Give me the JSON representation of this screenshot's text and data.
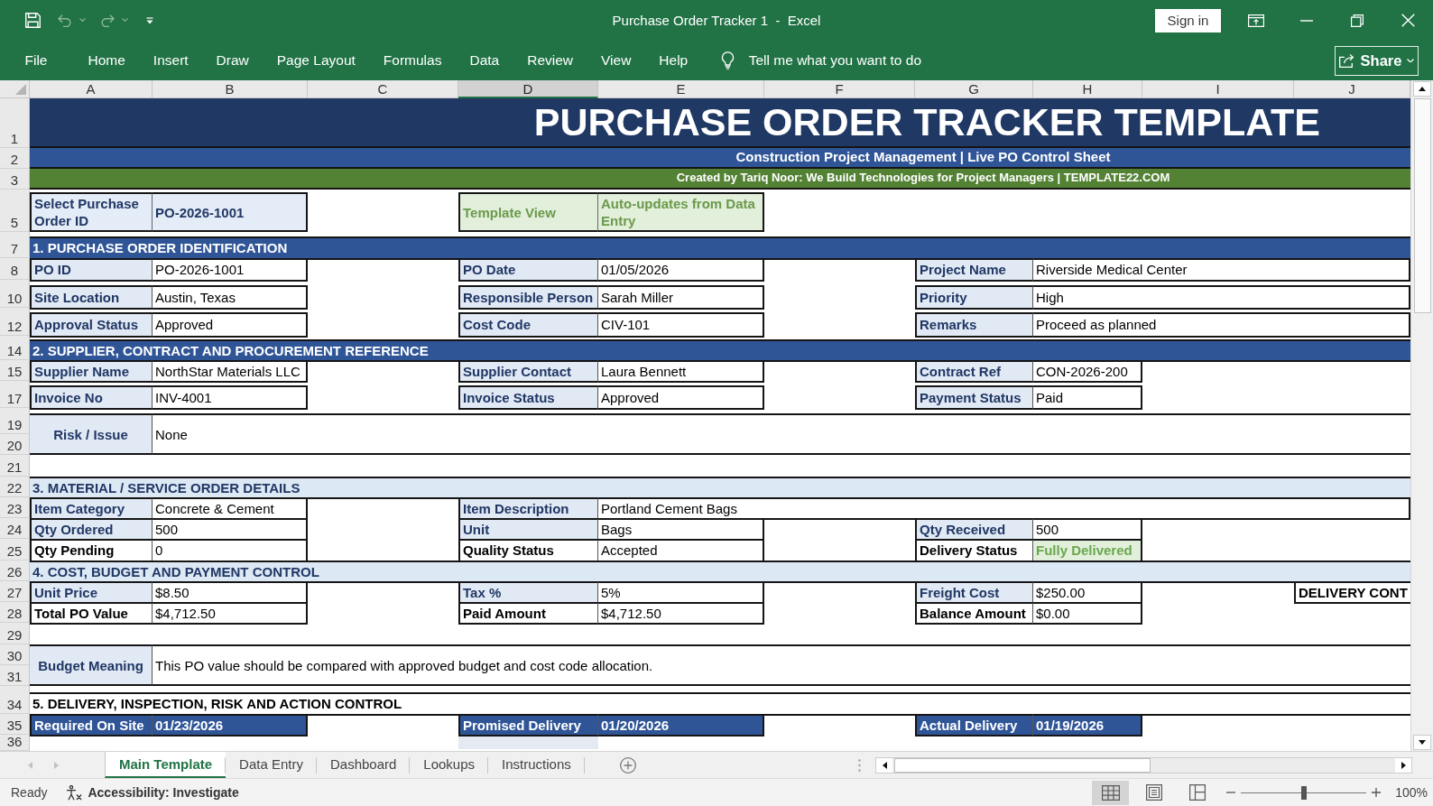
{
  "window": {
    "title": "Purchase Order Tracker 1  -  Excel",
    "sign_in": "Sign in"
  },
  "ribbon": {
    "tabs": [
      "File",
      "Home",
      "Insert",
      "Draw",
      "Page Layout",
      "Formulas",
      "Data",
      "Review",
      "View",
      "Help"
    ],
    "tell_me": "Tell me what you want to do",
    "share": "Share"
  },
  "sheet": {
    "columns": [
      {
        "label": "A",
        "selected": false
      },
      {
        "label": "B",
        "selected": false
      },
      {
        "label": "C",
        "selected": false
      },
      {
        "label": "D",
        "selected": true
      },
      {
        "label": "E",
        "selected": false
      },
      {
        "label": "F",
        "selected": false
      },
      {
        "label": "G",
        "selected": false
      },
      {
        "label": "H",
        "selected": false
      },
      {
        "label": "I",
        "selected": false
      },
      {
        "label": "J",
        "selected": false
      }
    ],
    "row_numbers": [
      "1",
      "2",
      "3",
      "5",
      "7",
      "8",
      "10",
      "12",
      "14",
      "15",
      "17",
      "19",
      "20",
      "21",
      "22",
      "23",
      "24",
      "25",
      "26",
      "27",
      "28",
      "29",
      "30",
      "31",
      "34",
      "35",
      "36"
    ],
    "title": "PURCHASE ORDER TRACKER TEMPLATE",
    "subtitle": "Construction Project Management | Live PO Control Sheet",
    "credit": "Created by Tariq Noor: We Build Technologies for Project Managers | TEMPLATE22.COM",
    "selector": {
      "label": "Select Purchase Order ID",
      "value": "PO-2026-1001",
      "view_label": "Template View",
      "view_note": "Auto-updates from Data Entry"
    },
    "sections": [
      {
        "heading": "1. PURCHASE ORDER IDENTIFICATION",
        "kind": "dark",
        "rows": [
          {
            "fields": [
              {
                "label": "PO ID",
                "value": "PO-2026-1001",
                "kind": "shaded"
              },
              {
                "label": "PO Date",
                "value": "01/05/2026",
                "kind": "shaded"
              },
              {
                "label": "Project Name",
                "value": "Riverside Medical Center",
                "kind": "shaded"
              }
            ]
          },
          {
            "fields": [
              {
                "label": "Site Location",
                "value": "Austin, Texas",
                "kind": "shaded"
              },
              {
                "label": "Responsible Person",
                "value": "Sarah Miller",
                "kind": "shaded"
              },
              {
                "label": "Priority",
                "value": "High",
                "kind": "shaded"
              }
            ]
          },
          {
            "fields": [
              {
                "label": "Approval Status",
                "value": "Approved",
                "kind": "shaded"
              },
              {
                "label": "Cost Code",
                "value": "CIV-101",
                "kind": "shaded"
              },
              {
                "label": "Remarks",
                "value": "Proceed as planned",
                "kind": "shaded"
              }
            ]
          }
        ]
      },
      {
        "heading": "2. SUPPLIER, CONTRACT AND PROCUREMENT REFERENCE",
        "kind": "dark",
        "rows": [
          {
            "fields": [
              {
                "label": "Supplier Name",
                "value": "NorthStar Materials LLC",
                "kind": "shaded"
              },
              {
                "label": "Supplier Contact",
                "value": "Laura Bennett",
                "kind": "shaded"
              },
              {
                "label": "Contract Ref",
                "value": "CON-2026-200",
                "kind": "shaded"
              }
            ]
          },
          {
            "fields": [
              {
                "label": "Invoice No",
                "value": "INV-4001",
                "kind": "shaded"
              },
              {
                "label": "Invoice Status",
                "value": "Approved",
                "kind": "shaded"
              },
              {
                "label": "Payment Status",
                "value": "Paid",
                "kind": "shaded"
              }
            ]
          }
        ],
        "note": {
          "label": "Risk / Issue",
          "value": "None"
        }
      },
      {
        "heading": "3. MATERIAL / SERVICE ORDER DETAILS",
        "kind": "light",
        "rows": [
          {
            "fields": [
              {
                "label": "Item Category",
                "value": "Concrete & Cement",
                "kind": "shaded"
              },
              {
                "label": "Item Description",
                "value": "Portland Cement Bags",
                "kind": "shaded"
              }
            ]
          },
          {
            "fields": [
              {
                "label": "Qty Ordered",
                "value": "500",
                "kind": "shaded"
              },
              {
                "label": "Unit",
                "value": "Bags",
                "kind": "shaded"
              },
              {
                "label": "Qty Received",
                "value": "500",
                "kind": "shaded"
              }
            ]
          },
          {
            "fields": [
              {
                "label": "Qty Pending",
                "value": "0",
                "kind": "plain"
              },
              {
                "label": "Quality Status",
                "value": "Accepted",
                "kind": "plain"
              },
              {
                "label": "Delivery Status",
                "value": "Fully Delivered",
                "kind": "status"
              }
            ]
          }
        ]
      },
      {
        "heading": "4. COST, BUDGET AND PAYMENT CONTROL",
        "kind": "light",
        "rows": [
          {
            "fields": [
              {
                "label": "Unit Price",
                "value": "$8.50",
                "kind": "shaded"
              },
              {
                "label": "Tax %",
                "value": "5%",
                "kind": "shaded"
              },
              {
                "label": "Freight Cost",
                "value": "$250.00",
                "kind": "shaded"
              }
            ],
            "aside": "DELIVERY CONT"
          },
          {
            "fields": [
              {
                "label": "Total PO Value",
                "value": "$4,712.50",
                "kind": "plain"
              },
              {
                "label": "Paid Amount",
                "value": "$4,712.50",
                "kind": "plain"
              },
              {
                "label": "Balance Amount",
                "value": "$0.00",
                "kind": "plain"
              }
            ]
          }
        ],
        "note": {
          "label": "Budget Meaning",
          "value": "This PO value should be compared with approved budget and cost code allocation."
        }
      },
      {
        "heading": "5. DELIVERY, INSPECTION, RISK AND ACTION CONTROL",
        "kind": "plain",
        "rows": [
          {
            "fields": [
              {
                "label": "Required On Site",
                "value": "01/23/2026",
                "kind": "dark"
              },
              {
                "label": "Promised Delivery",
                "value": "01/20/2026",
                "kind": "dark"
              },
              {
                "label": "Actual Delivery",
                "value": "01/19/2026",
                "kind": "dark"
              }
            ]
          }
        ]
      }
    ]
  },
  "sheet_tabs": [
    {
      "label": "Main Template",
      "selected": true
    },
    {
      "label": "Data Entry",
      "selected": false
    },
    {
      "label": "Dashboard",
      "selected": false
    },
    {
      "label": "Lookups",
      "selected": false
    },
    {
      "label": "Instructions",
      "selected": false
    }
  ],
  "status_bar": {
    "status": "Ready",
    "accessibility": "Accessibility: Investigate",
    "views": [
      {
        "kind": "normal",
        "selected": true
      },
      {
        "kind": "page_layout",
        "selected": false
      },
      {
        "kind": "page_break",
        "selected": false
      }
    ],
    "zoom": {
      "level": 0.5,
      "reading": "100%"
    }
  }
}
